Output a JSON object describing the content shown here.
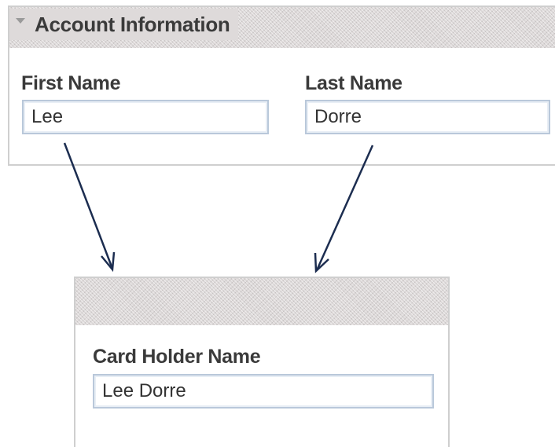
{
  "account_panel": {
    "title": "Account Information",
    "first_name": {
      "label": "First Name",
      "value": "Lee"
    },
    "last_name": {
      "label": "Last Name",
      "value": "Dorre"
    }
  },
  "card_panel": {
    "card_holder": {
      "label": "Card Holder Name",
      "value": "Lee Dorre"
    }
  },
  "colors": {
    "arrow": "#1c2d50",
    "input_border": "#b9c8da",
    "label_text": "#3a3a3a"
  },
  "icons": {
    "collapse": "collapse-triangle-icon"
  }
}
